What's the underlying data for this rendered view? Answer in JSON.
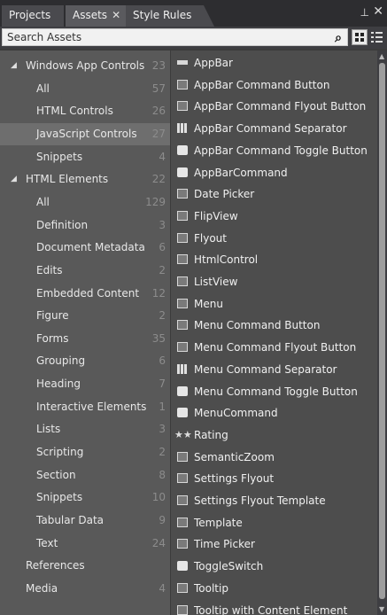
{
  "tabs": [
    {
      "label": "Projects"
    },
    {
      "label": "Assets",
      "close": "✕"
    },
    {
      "label": "Style Rules"
    }
  ],
  "window_controls": {
    "pin": "⊥",
    "close": "✕"
  },
  "search": {
    "placeholder": "Search Assets",
    "icon": "search-icon"
  },
  "tree": [
    {
      "label": "Windows App Controls",
      "count": "23",
      "expanded": true,
      "level": 0
    },
    {
      "label": "All",
      "count": "57",
      "level": 1
    },
    {
      "label": "HTML Controls",
      "count": "26",
      "level": 1
    },
    {
      "label": "JavaScript Controls",
      "count": "27",
      "level": 1,
      "selected": true
    },
    {
      "label": "Snippets",
      "count": "4",
      "level": 1
    },
    {
      "label": "HTML Elements",
      "count": "22",
      "expanded": true,
      "level": 0
    },
    {
      "label": "All",
      "count": "129",
      "level": 1
    },
    {
      "label": "Definition",
      "count": "3",
      "level": 1
    },
    {
      "label": "Document Metadata",
      "count": "6",
      "level": 1
    },
    {
      "label": "Edits",
      "count": "2",
      "level": 1
    },
    {
      "label": "Embedded Content",
      "count": "12",
      "level": 1
    },
    {
      "label": "Figure",
      "count": "2",
      "level": 1
    },
    {
      "label": "Forms",
      "count": "35",
      "level": 1
    },
    {
      "label": "Grouping",
      "count": "6",
      "level": 1
    },
    {
      "label": "Heading",
      "count": "7",
      "level": 1
    },
    {
      "label": "Interactive Elements",
      "count": "1",
      "level": 1
    },
    {
      "label": "Lists",
      "count": "3",
      "level": 1
    },
    {
      "label": "Scripting",
      "count": "2",
      "level": 1
    },
    {
      "label": "Section",
      "count": "8",
      "level": 1
    },
    {
      "label": "Snippets",
      "count": "10",
      "level": 1
    },
    {
      "label": "Tabular Data",
      "count": "9",
      "level": 1
    },
    {
      "label": "Text",
      "count": "24",
      "level": 1
    },
    {
      "label": "References",
      "count": "",
      "level": 0
    },
    {
      "label": "Media",
      "count": "4",
      "level": 0
    }
  ],
  "assets": [
    {
      "label": "AppBar",
      "icon": "bar"
    },
    {
      "label": "AppBar Command Button",
      "icon": "box"
    },
    {
      "label": "AppBar Command Flyout Button",
      "icon": "box"
    },
    {
      "label": "AppBar Command Separator",
      "icon": "grid"
    },
    {
      "label": "AppBar Command Toggle Button",
      "icon": "dark"
    },
    {
      "label": "AppBarCommand",
      "icon": "dark"
    },
    {
      "label": "Date Picker",
      "icon": "box"
    },
    {
      "label": "FlipView",
      "icon": "box"
    },
    {
      "label": "Flyout",
      "icon": "box"
    },
    {
      "label": "HtmlControl",
      "icon": "box"
    },
    {
      "label": "ListView",
      "icon": "box"
    },
    {
      "label": "Menu",
      "icon": "box"
    },
    {
      "label": "Menu Command Button",
      "icon": "box"
    },
    {
      "label": "Menu Command Flyout Button",
      "icon": "box"
    },
    {
      "label": "Menu Command Separator",
      "icon": "grid"
    },
    {
      "label": "Menu Command Toggle Button",
      "icon": "dark"
    },
    {
      "label": "MenuCommand",
      "icon": "dark"
    },
    {
      "label": "Rating",
      "icon": "star"
    },
    {
      "label": "SemanticZoom",
      "icon": "box"
    },
    {
      "label": "Settings Flyout",
      "icon": "box"
    },
    {
      "label": "Settings Flyout Template",
      "icon": "box"
    },
    {
      "label": "Template",
      "icon": "box"
    },
    {
      "label": "Time Picker",
      "icon": "box"
    },
    {
      "label": "ToggleSwitch",
      "icon": "dark"
    },
    {
      "label": "Tooltip",
      "icon": "box"
    },
    {
      "label": "Tooltip with Content Element",
      "icon": "box"
    }
  ]
}
